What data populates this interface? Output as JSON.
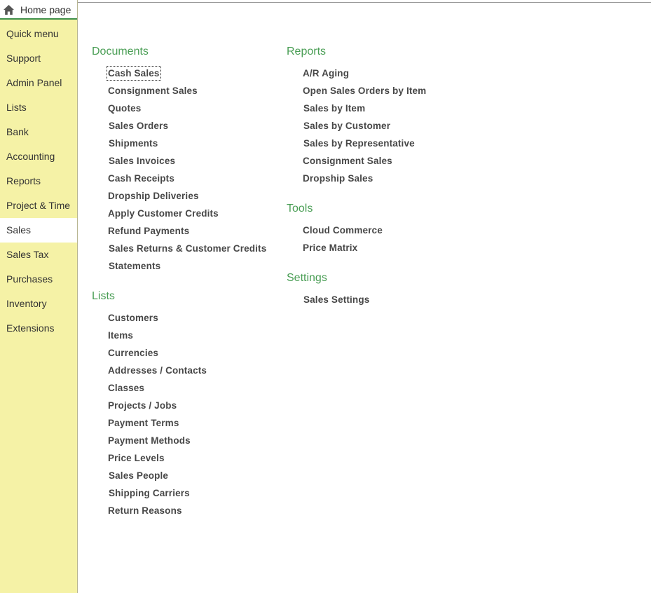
{
  "home_tab": {
    "label": "Home page"
  },
  "sidebar": {
    "items": [
      {
        "label": "Quick menu"
      },
      {
        "label": "Support"
      },
      {
        "label": "Admin Panel"
      },
      {
        "label": "Lists"
      },
      {
        "label": "Bank"
      },
      {
        "label": "Accounting"
      },
      {
        "label": "Reports"
      },
      {
        "label": "Project & Time"
      },
      {
        "label": "Sales",
        "active": true
      },
      {
        "label": "Sales Tax"
      },
      {
        "label": "Purchases"
      },
      {
        "label": "Inventory"
      },
      {
        "label": "Extensions"
      }
    ]
  },
  "documents": {
    "title": "Documents",
    "links": [
      "Cash Sales",
      "Consignment Sales",
      "Quotes",
      "Sales Orders",
      "Shipments",
      "Sales Invoices",
      "Cash Receipts",
      "Dropship Deliveries",
      "Apply Customer Credits",
      "Refund Payments",
      "Sales Returns & Customer Credits",
      "Statements"
    ]
  },
  "lists": {
    "title": "Lists",
    "links": [
      "Customers",
      "Items",
      "Currencies",
      "Addresses / Contacts",
      "Classes",
      "Projects / Jobs",
      "Payment Terms",
      "Payment Methods",
      "Price Levels",
      "Sales People",
      "Shipping Carriers",
      "Return Reasons"
    ]
  },
  "reports": {
    "title": "Reports",
    "links": [
      "A/R Aging",
      "Open Sales Orders by Item",
      "Sales by Item",
      "Sales by Customer",
      "Sales by Representative",
      "Consignment Sales",
      "Dropship Sales"
    ]
  },
  "tools": {
    "title": "Tools",
    "links": [
      "Cloud Commerce",
      "Price Matrix"
    ]
  },
  "settings": {
    "title": "Settings",
    "links": [
      "Sales Settings"
    ]
  },
  "colors": {
    "sidebar_bg": "#f5f2a6",
    "section_title": "#4a9e55",
    "link_text": "#474747",
    "active_underline": "#3f8f4a"
  },
  "icons": {
    "home": "home-icon"
  }
}
